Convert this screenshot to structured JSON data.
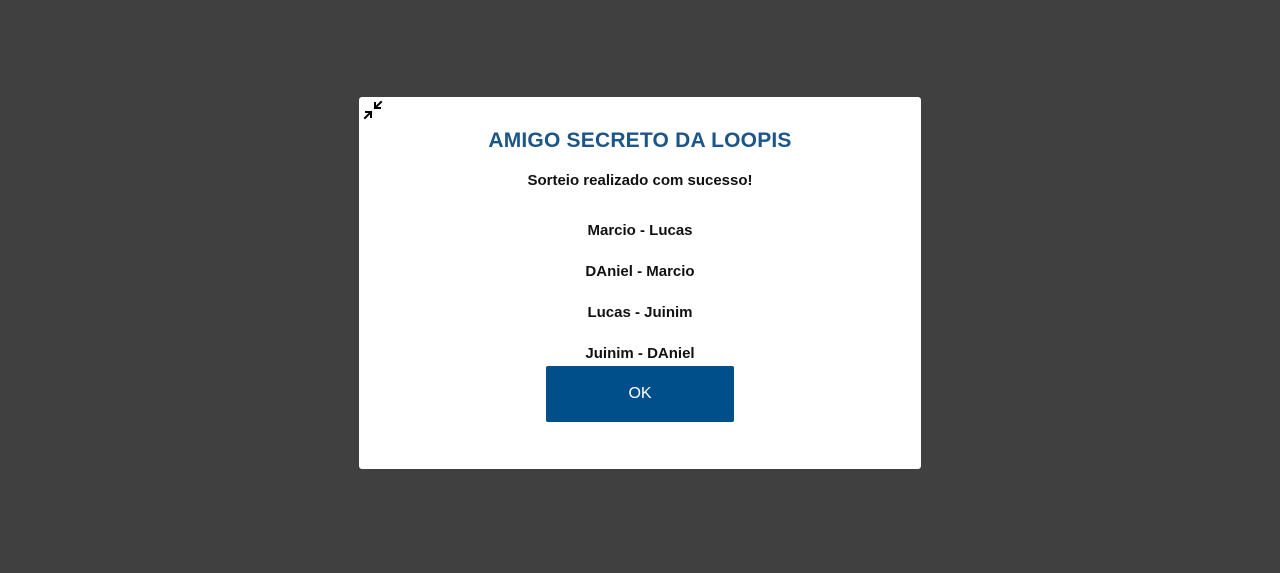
{
  "modal": {
    "title": "AMIGO SECRETO DA LOOPIS",
    "message": "Sorteio realizado com sucesso!",
    "pairs": [
      "Marcio - Lucas",
      "DAniel - Marcio",
      "Lucas - Juinim",
      "Juinim - DAniel"
    ],
    "ok_label": "OK",
    "collapse_icon": "collapse-arrows-icon"
  },
  "colors": {
    "backdrop": "#404040",
    "title": "#1c5689",
    "button": "#004f8a"
  }
}
